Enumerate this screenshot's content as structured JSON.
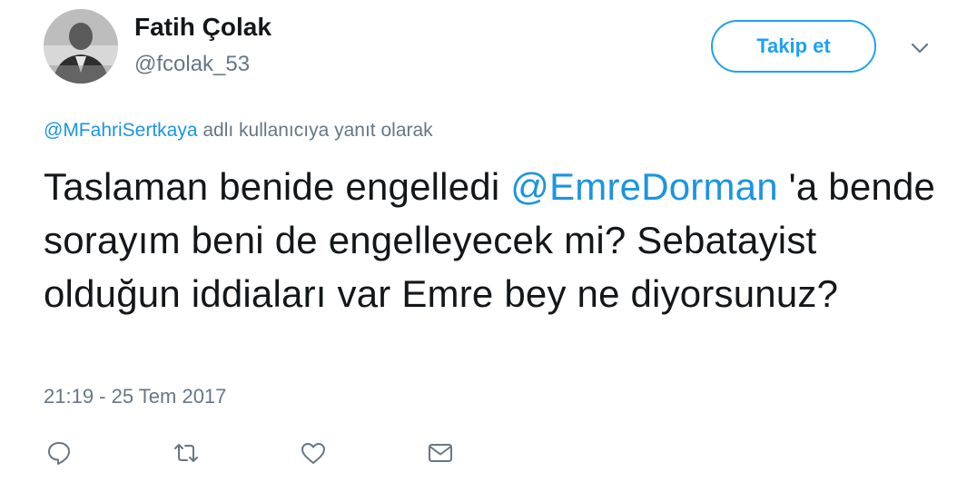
{
  "author": {
    "name": "Fatih Çolak",
    "handle": "@fcolak_53"
  },
  "follow_button": {
    "label": "Takip et"
  },
  "reply_to": {
    "mention": "@MFahriSertkaya",
    "suffix": " adlı kullanıcıya yanıt olarak"
  },
  "tweet": {
    "part1": "Taslaman benide engelledi ",
    "mention": "@EmreDorman",
    "part2": " 'a bende sorayım beni de engelleyecek mi? Sebatayist olduğun iddiaları var Emre bey ne diyorsunuz?"
  },
  "timestamp": "21:19 - 25 Tem 2017",
  "actions": [
    {
      "icon": "reply-icon"
    },
    {
      "icon": "retweet-icon"
    },
    {
      "icon": "heart-icon"
    },
    {
      "icon": "message-icon"
    }
  ],
  "colors": {
    "accent": "#1da1f2",
    "link": "#1b95e0",
    "muted": "#657786",
    "text": "#14171a"
  }
}
